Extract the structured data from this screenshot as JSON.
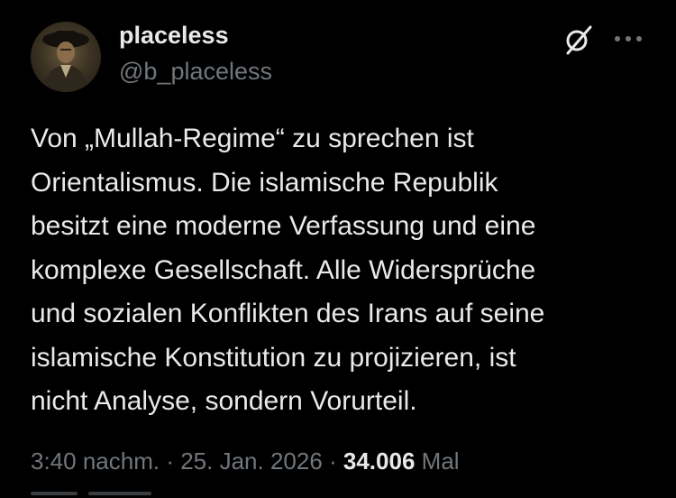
{
  "author": {
    "display_name": "placeless",
    "handle": "@b_placeless"
  },
  "tweet": {
    "lines": [
      "Von „Mullah-Regime“ zu sprechen ist",
      "Orientalismus. Die islamische Republik",
      "besitzt eine moderne Verfassung und eine",
      "komplexe Gesellschaft. Alle Widersprüche",
      "und sozialen Konflikten des Irans auf seine",
      "islamische Konstitution zu projizieren, ist",
      "nicht Analyse, sondern Vorurteil."
    ]
  },
  "meta": {
    "time": "3:40 nachm.",
    "separator": " · ",
    "date": "25. Jan. 2026",
    "views_count": "34.006",
    "views_label": "Mal"
  },
  "icons": {
    "grok": "grok-icon",
    "more": "more-options-icon"
  },
  "colors": {
    "background": "#000000",
    "primary_text": "#e7e9ea",
    "secondary_text": "#71767b"
  }
}
